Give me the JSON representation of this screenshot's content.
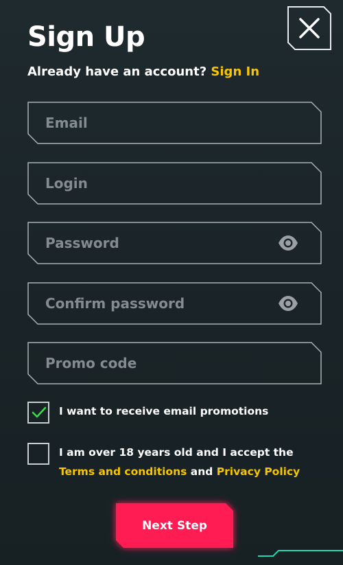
{
  "header": {
    "title": "Sign Up",
    "subtitle_prefix": "Already have an account?",
    "sign_in_link": "Sign In"
  },
  "close_button": {
    "icon": "close-icon"
  },
  "form": {
    "email_placeholder": "Email",
    "email_value": "",
    "login_placeholder": "Login",
    "login_value": "",
    "password_placeholder": "Password",
    "password_value": "",
    "confirm_password_placeholder": "Confirm password",
    "confirm_password_value": "",
    "promo_placeholder": "Promo code",
    "promo_value": ""
  },
  "checkboxes": {
    "promotions": {
      "label": "I want to receive email promotions",
      "checked": true
    },
    "terms": {
      "label_line1": "I am over 18 years old and I accept the",
      "terms_link": "Terms and conditions",
      "and": "and",
      "privacy_link": "Privacy Policy",
      "checked": false
    }
  },
  "submit": {
    "label": "Next Step"
  },
  "colors": {
    "accent": "#f7c600",
    "button": "#ff1a52",
    "check": "#3ddc4a",
    "border": "#aab1b5",
    "placeholder": "#858c91",
    "deco": "#1fd6b4"
  }
}
